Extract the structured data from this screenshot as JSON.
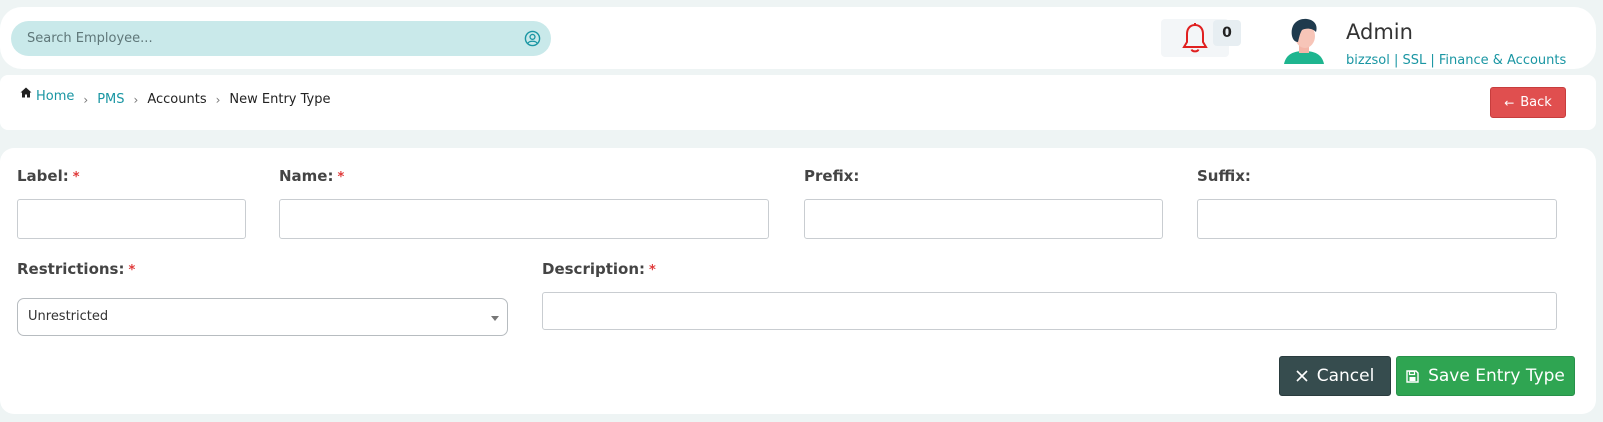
{
  "header": {
    "search_placeholder": "Search Employee...",
    "notification_count": "0",
    "user_name": "Admin",
    "user_meta": "bizzsol | SSL  | Finance & Accounts"
  },
  "breadcrumb": {
    "items": [
      "Home",
      "PMS",
      "Accounts",
      "New Entry Type"
    ],
    "separator": "›",
    "back_label": "Back"
  },
  "form": {
    "label": {
      "label": "Label:",
      "required": "*",
      "value": ""
    },
    "name": {
      "label": "Name:",
      "required": "*",
      "value": ""
    },
    "prefix": {
      "label": "Prefix:",
      "value": ""
    },
    "suffix": {
      "label": "Suffix:",
      "value": ""
    },
    "restrictions": {
      "label": "Restrictions:",
      "required": "*",
      "selected": "Unrestricted"
    },
    "description": {
      "label": "Description:",
      "required": "*",
      "value": ""
    },
    "cancel_label": "Cancel",
    "save_label": "Save Entry Type"
  },
  "colors": {
    "accent": "#1a96a3",
    "danger": "#e04f4f",
    "success": "#2fa552",
    "dark": "#364c4e",
    "bell": "#e02020"
  },
  "icons": [
    "user-circle-icon",
    "bell-icon",
    "avatar",
    "home-icon",
    "arrow-left-icon",
    "close-icon",
    "save-icon"
  ]
}
